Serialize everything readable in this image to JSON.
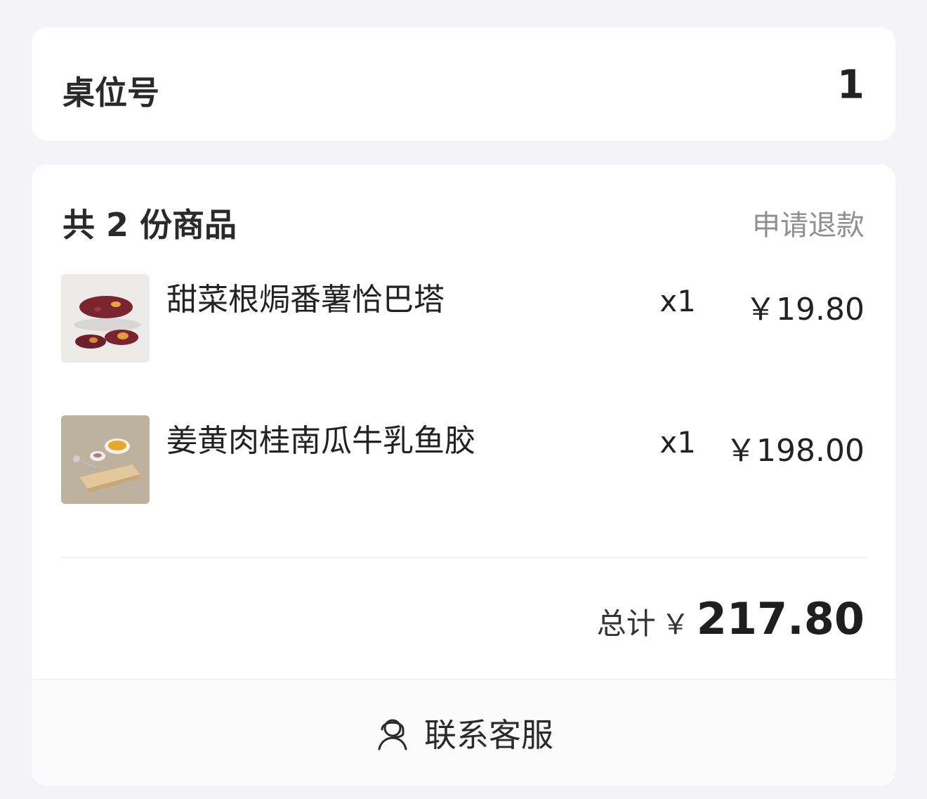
{
  "table": {
    "label": "桌位号",
    "value": "1"
  },
  "order": {
    "count_title": "共 2 份商品",
    "refund_label": "申请退款",
    "items": [
      {
        "name": "甜菜根焗番薯恰巴塔",
        "qty": "x1",
        "price": "￥19.80",
        "thumb_icon": "bread-photo"
      },
      {
        "name": "姜黄肉桂南瓜牛乳鱼胶",
        "qty": "x1",
        "price": "￥198.00",
        "thumb_icon": "dessert-photo"
      }
    ],
    "total_label": "总计",
    "total_currency": "￥",
    "total_amount": "217.80"
  },
  "footer": {
    "label": "联系客服",
    "icon": "customer-service-icon"
  }
}
